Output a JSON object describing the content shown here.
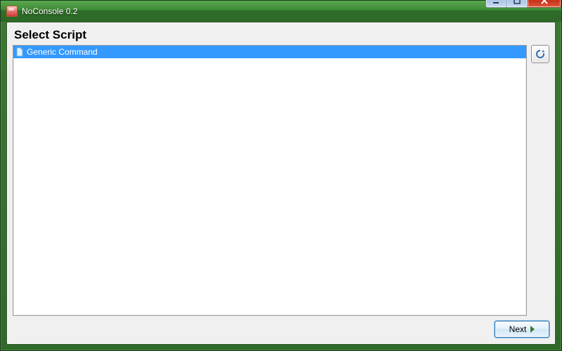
{
  "window": {
    "title": "NoConsole 0.2"
  },
  "page": {
    "heading": "Select Script"
  },
  "scripts": {
    "items": [
      {
        "label": "Generic Command",
        "selected": true
      }
    ]
  },
  "actions": {
    "next_label": "Next"
  }
}
